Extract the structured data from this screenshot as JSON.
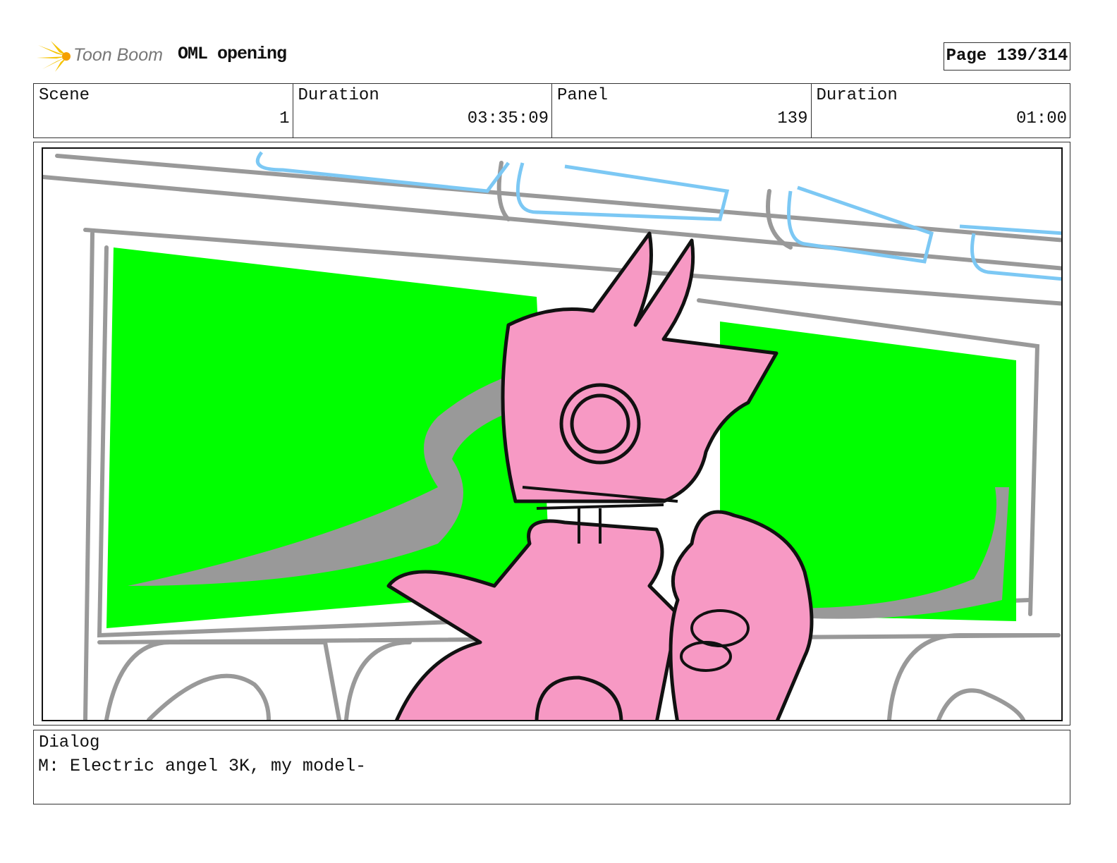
{
  "header": {
    "logo_text": "Toon Boom",
    "project_title": "OML opening",
    "page_label": "Page 139/314"
  },
  "info": {
    "scene_label": "Scene",
    "scene_value": "1",
    "scene_duration_label": "Duration",
    "scene_duration_value": "03:35:09",
    "panel_label": "Panel",
    "panel_value": "139",
    "panel_duration_label": "Duration",
    "panel_duration_value": "01:00"
  },
  "dialog": {
    "label": "Dialog",
    "text": "M: Electric angel 3K, my model-"
  },
  "colors": {
    "green": "#00ff00",
    "pink": "#f799c4",
    "gray": "#999999",
    "blue": "#7cc8f4"
  }
}
